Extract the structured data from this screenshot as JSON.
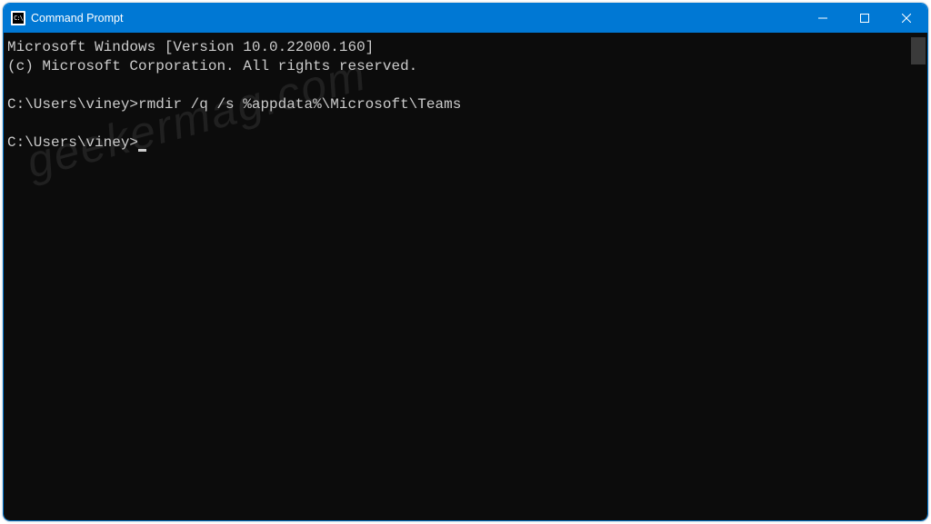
{
  "window": {
    "title": "Command Prompt"
  },
  "terminal": {
    "line1": "Microsoft Windows [Version 10.0.22000.160]",
    "line2": "(c) Microsoft Corporation. All rights reserved.",
    "prompt1": "C:\\Users\\viney>",
    "command1": "rmdir /q /s %appdata%\\Microsoft\\Teams",
    "prompt2": "C:\\Users\\viney>"
  },
  "watermark": "geekermag.com"
}
